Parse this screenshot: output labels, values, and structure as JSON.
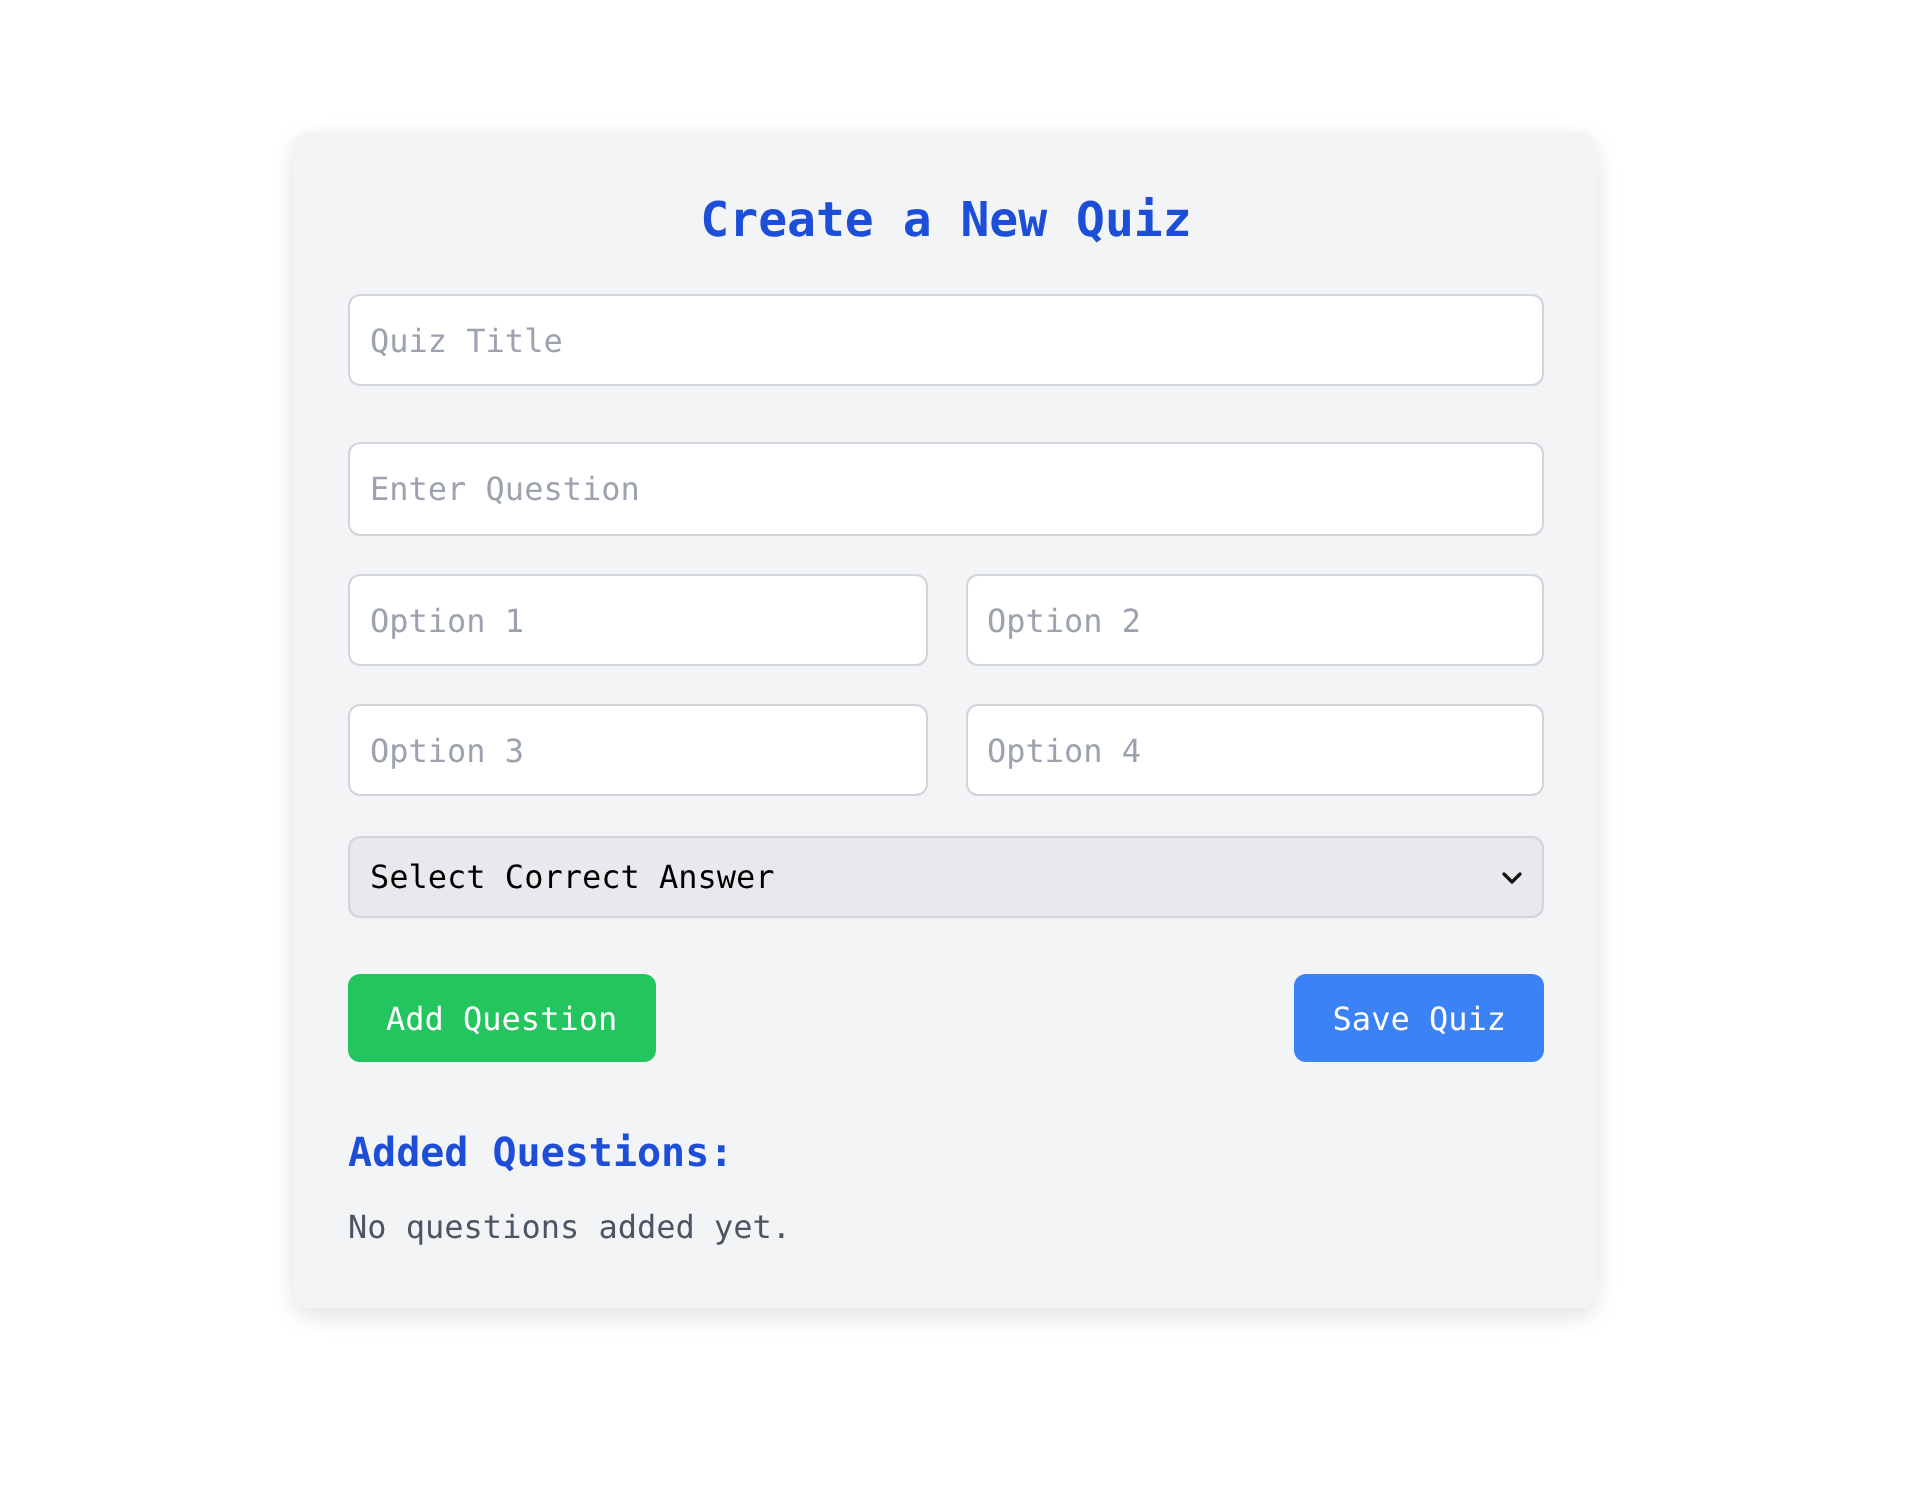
{
  "heading": "Create a New Quiz",
  "quiz_title": {
    "placeholder": "Quiz Title"
  },
  "question": {
    "placeholder": "Enter Question"
  },
  "options": [
    {
      "placeholder": "Option 1"
    },
    {
      "placeholder": "Option 2"
    },
    {
      "placeholder": "Option 3"
    },
    {
      "placeholder": "Option 4"
    }
  ],
  "correct_answer": {
    "value": "Select Correct Answer"
  },
  "buttons": [
    {
      "label": "Add Question",
      "kind": "add"
    },
    {
      "label": "Save Quiz",
      "kind": "save"
    }
  ],
  "added_questions": {
    "heading": "Added Questions:",
    "empty_text": "No questions added yet."
  }
}
